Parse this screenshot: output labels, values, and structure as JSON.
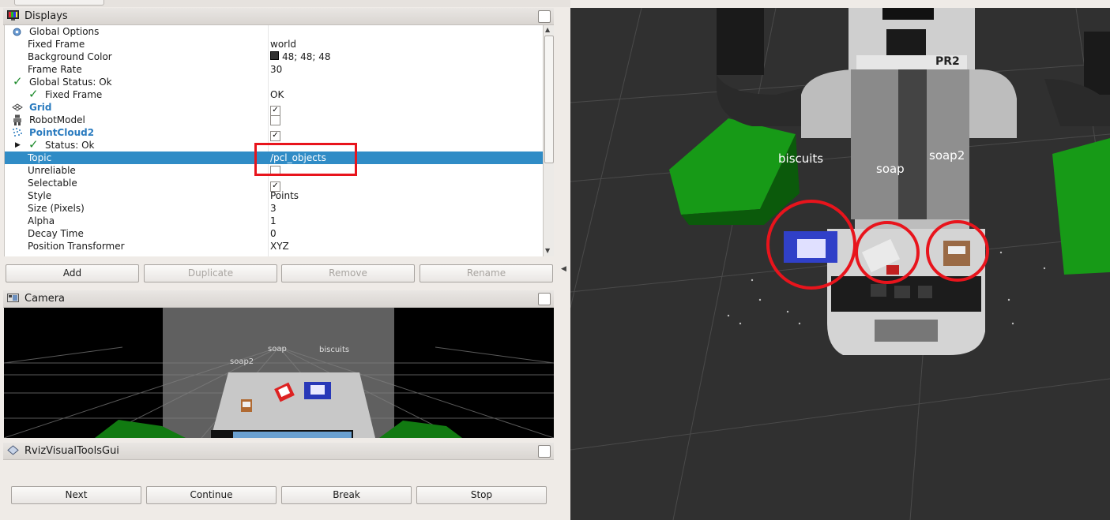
{
  "displays_panel": {
    "title": "Displays",
    "rows": [
      {
        "name": "Global Options",
        "value": ""
      },
      {
        "name": "Fixed Frame",
        "value": "world"
      },
      {
        "name": "Background Color",
        "value": "48; 48; 48"
      },
      {
        "name": "Frame Rate",
        "value": "30"
      },
      {
        "name": "Global Status: Ok",
        "value": ""
      },
      {
        "name": "Fixed Frame",
        "value": "OK"
      },
      {
        "name": "Grid",
        "value": ""
      },
      {
        "name": "RobotModel",
        "value": ""
      },
      {
        "name": "PointCloud2",
        "value": ""
      },
      {
        "name": "Status: Ok",
        "value": ""
      },
      {
        "name": "Topic",
        "value": "/pcl_objects"
      },
      {
        "name": "Unreliable",
        "value": ""
      },
      {
        "name": "Selectable",
        "value": ""
      },
      {
        "name": "Style",
        "value": "Points"
      },
      {
        "name": "Size (Pixels)",
        "value": "3"
      },
      {
        "name": "Alpha",
        "value": "1"
      },
      {
        "name": "Decay Time",
        "value": "0"
      },
      {
        "name": "Position Transformer",
        "value": "XYZ"
      }
    ],
    "checks": {
      "grid": true,
      "robotmodel": false,
      "pointcloud2": true,
      "unreliable": false,
      "selectable": true
    },
    "background_color_hex": "#303030"
  },
  "buttons": {
    "add": "Add",
    "duplicate": "Duplicate",
    "remove": "Remove",
    "rename": "Rename"
  },
  "camera_panel": {
    "title": "Camera",
    "labels": {
      "soap": "soap",
      "biscuits": "biscuits",
      "soap2": "soap2"
    }
  },
  "tools_panel": {
    "title": "RvizVisualToolsGui",
    "buttons": {
      "next": "Next",
      "continue": "Continue",
      "break": "Break",
      "stop": "Stop"
    }
  },
  "viewport": {
    "labels": {
      "biscuits": "biscuits",
      "soap": "soap",
      "soap2": "soap2",
      "robot_badge": "PR2"
    }
  },
  "colors": {
    "selection": "#308cc6",
    "highlight": "#e8141c",
    "green_box": "#1ea01e",
    "viewport_bg": "#303030"
  }
}
